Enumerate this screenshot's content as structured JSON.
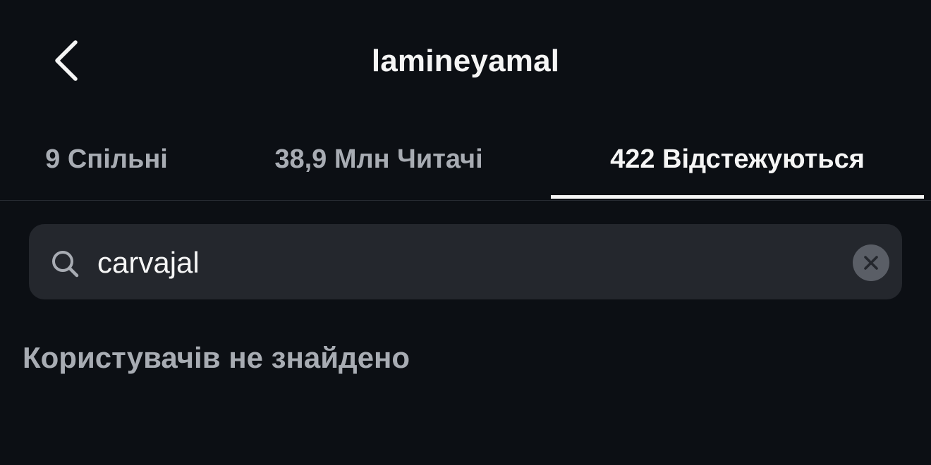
{
  "header": {
    "title": "lamineyamal",
    "back_icon": "chevron-left-icon"
  },
  "tabs": [
    {
      "label": "9 Спільні",
      "active": false
    },
    {
      "label": "38,9 Млн Читачі",
      "active": false
    },
    {
      "label": "422 Відстежуються",
      "active": true
    }
  ],
  "search": {
    "value": "carvajal",
    "icon": "search-icon",
    "clear_icon": "clear-icon"
  },
  "results": {
    "empty_message": "Користувачів не знайдено"
  },
  "colors": {
    "background": "#0c0f14",
    "search_bg": "#24272d",
    "text_primary": "#f5f5f5",
    "text_secondary": "#a8acb3"
  }
}
